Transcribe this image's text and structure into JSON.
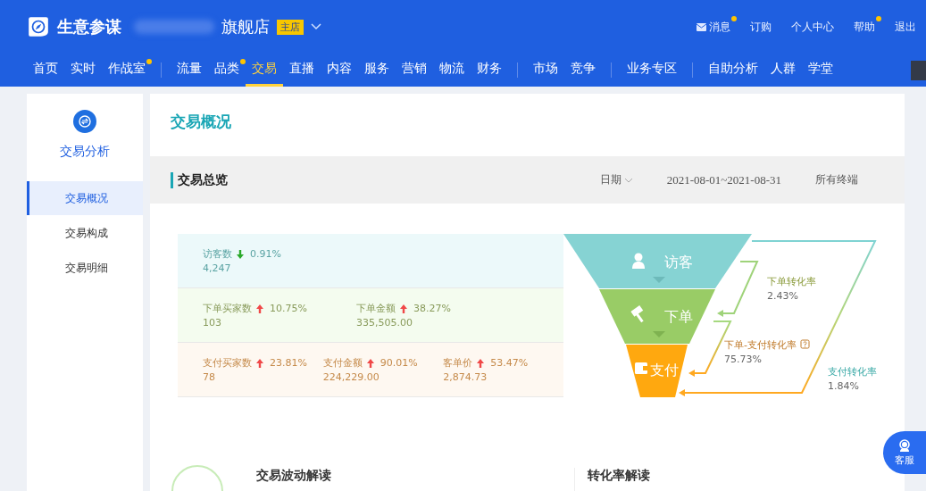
{
  "header": {
    "logo": "生意参谋",
    "shop": "旗舰店",
    "shop_badge": "主店",
    "top_links": [
      {
        "label": "消息",
        "dot": true
      },
      {
        "label": "订购",
        "dot": false
      },
      {
        "label": "个人中心",
        "dot": false
      },
      {
        "label": "帮助",
        "dot": true
      },
      {
        "label": "退出",
        "dot": false
      }
    ],
    "nav_groups": [
      [
        {
          "label": "首页",
          "selected": false,
          "dot": false
        },
        {
          "label": "实时",
          "selected": false,
          "dot": false
        },
        {
          "label": "作战室",
          "selected": false,
          "dot": true
        }
      ],
      [
        {
          "label": "流量",
          "selected": false,
          "dot": false
        },
        {
          "label": "品类",
          "selected": false,
          "dot": true
        },
        {
          "label": "交易",
          "selected": true,
          "dot": false
        },
        {
          "label": "直播",
          "selected": false,
          "dot": false
        },
        {
          "label": "内容",
          "selected": false,
          "dot": false
        },
        {
          "label": "服务",
          "selected": false,
          "dot": false
        },
        {
          "label": "营销",
          "selected": false,
          "dot": false
        },
        {
          "label": "物流",
          "selected": false,
          "dot": false
        },
        {
          "label": "财务",
          "selected": false,
          "dot": false
        }
      ],
      [
        {
          "label": "市场",
          "selected": false,
          "dot": false
        },
        {
          "label": "竞争",
          "selected": false,
          "dot": false
        }
      ],
      [
        {
          "label": "业务专区",
          "selected": false,
          "dot": false
        }
      ],
      [
        {
          "label": "自助分析",
          "selected": false,
          "dot": false
        },
        {
          "label": "人群",
          "selected": false,
          "dot": false
        },
        {
          "label": "学堂",
          "selected": false,
          "dot": false
        }
      ]
    ]
  },
  "sidebar": {
    "title": "交易分析",
    "items": [
      {
        "label": "交易概况",
        "selected": true
      },
      {
        "label": "交易构成",
        "selected": false
      },
      {
        "label": "交易明细",
        "selected": false
      }
    ]
  },
  "page_title": "交易概况",
  "overview": {
    "title": "交易总览",
    "date_label": "日期",
    "date_range": "2021-08-01~2021-08-31",
    "terminal": "所有终端"
  },
  "funnel": {
    "rows": [
      {
        "kind": "visit",
        "metrics": [
          {
            "label": "访客数",
            "up": false,
            "change": "0.91%",
            "value": "4,247"
          }
        ]
      },
      {
        "kind": "order",
        "metrics": [
          {
            "label": "下单买家数",
            "up": true,
            "change": "10.75%",
            "value": "103"
          },
          {
            "label": "下单金额",
            "up": true,
            "change": "38.27%",
            "value": "335,505.00"
          }
        ]
      },
      {
        "kind": "pay",
        "metrics": [
          {
            "label": "支付买家数",
            "up": true,
            "change": "23.81%",
            "value": "78"
          },
          {
            "label": "支付金额",
            "up": true,
            "change": "90.01%",
            "value": "224,229.00"
          },
          {
            "label": "客单价",
            "up": true,
            "change": "53.47%",
            "value": "2,874.73"
          }
        ]
      }
    ],
    "stages": [
      {
        "kind": "visit",
        "label": "访客"
      },
      {
        "kind": "order",
        "label": "下单"
      },
      {
        "kind": "pay",
        "label": "支付"
      }
    ],
    "rates": [
      {
        "kind": "order",
        "label": "下单转化率",
        "value": "2.43%"
      },
      {
        "kind": "order_pay",
        "label": "下单-支付转化率",
        "value": "75.73%",
        "help": true
      },
      {
        "kind": "pay",
        "label": "支付转化率",
        "value": "1.84%"
      }
    ]
  },
  "insights": [
    {
      "title": "交易波动解读"
    },
    {
      "title": "转化率解读"
    }
  ],
  "service_button": "客服"
}
